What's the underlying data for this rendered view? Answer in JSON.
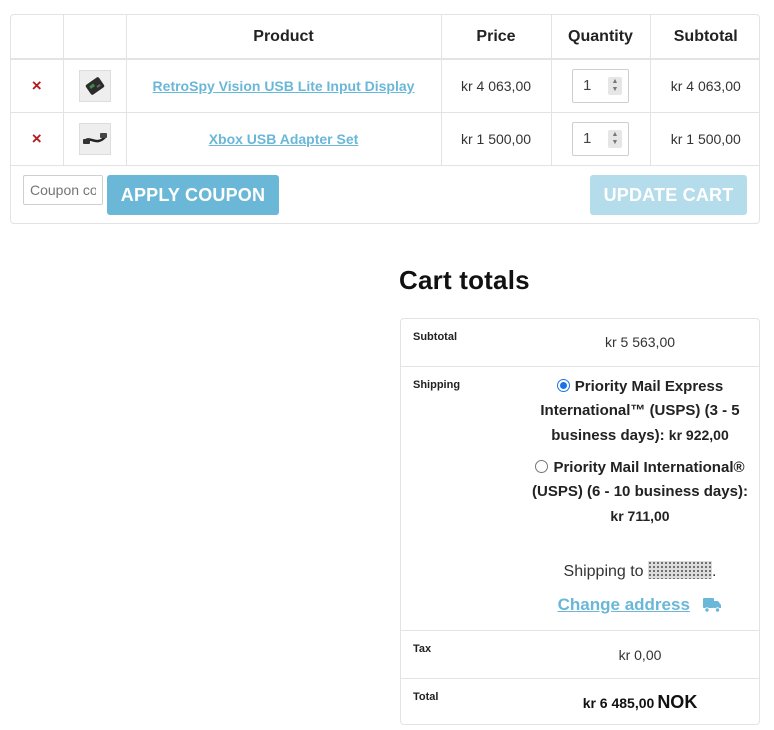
{
  "cart": {
    "headers": {
      "remove": "",
      "thumb": "",
      "product": "Product",
      "price": "Price",
      "quantity": "Quantity",
      "subtotal": "Subtotal"
    },
    "remove_symbol": "×",
    "items": [
      {
        "name": "RetroSpy Vision USB Lite Input Display",
        "price": "kr 4 063,00",
        "quantity": "1",
        "subtotal": "kr 4 063,00"
      },
      {
        "name": "Xbox USB Adapter Set",
        "price": "kr 1 500,00",
        "quantity": "1",
        "subtotal": "kr 1 500,00"
      }
    ],
    "coupon_placeholder": "Coupon code",
    "apply_coupon_label": "APPLY COUPON",
    "update_cart_label": "UPDATE CART"
  },
  "totals": {
    "title": "Cart totals",
    "subtotal_label": "Subtotal",
    "subtotal_value": "kr 5 563,00",
    "shipping_label": "Shipping",
    "shipping_options": [
      {
        "label": "Priority Mail Express International™ (USPS) (3 - 5 business days):",
        "price": "kr 922,00",
        "selected": true
      },
      {
        "label": "Priority Mail International® (USPS) (6 - 10 business days):",
        "price": "kr 711,00",
        "selected": false
      }
    ],
    "shipping_to_label": "Shipping to",
    "shipping_to_end": ".",
    "change_address_label": "Change address",
    "tax_label": "Tax",
    "tax_value": "kr 0,00",
    "total_label": "Total",
    "total_value": "kr 6 485,00",
    "total_currency": "NOK"
  },
  "colors": {
    "link": "#6ab7d8",
    "apply_button": "#6ab7d8",
    "update_button_disabled": "#b5dceb",
    "remove": "#b51d1d",
    "radio_selected": "#1a73e8"
  },
  "icons": {
    "remove": "close-icon",
    "truck": "truck-icon",
    "spinner": "spinner-arrows-icon"
  }
}
